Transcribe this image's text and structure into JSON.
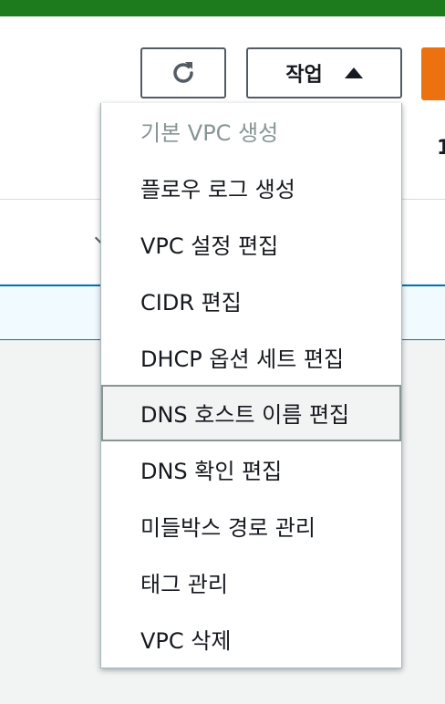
{
  "header": {
    "refresh_icon": "refresh-icon",
    "actions_label": "작업",
    "actions_caret_icon": "caret-up-icon",
    "side_text": "1"
  },
  "menu": {
    "items": [
      {
        "label": "기본 VPC 생성",
        "disabled": true
      },
      {
        "label": "플로우 로그 생성"
      },
      {
        "label": "VPC 설정 편집"
      },
      {
        "label": "CIDR 편집"
      },
      {
        "label": "DHCP 옵션 세트 편집"
      },
      {
        "label": "DNS 호스트 이름 편집",
        "highlighted": true
      },
      {
        "label": "DNS 확인 편집"
      },
      {
        "label": "미들박스 경로 관리"
      },
      {
        "label": "태그 관리"
      },
      {
        "label": "VPC 삭제"
      }
    ]
  },
  "colors": {
    "top_bar": "#1d7a1d",
    "primary_button": "#ec7211",
    "selected_row_border": "#0073bb"
  }
}
